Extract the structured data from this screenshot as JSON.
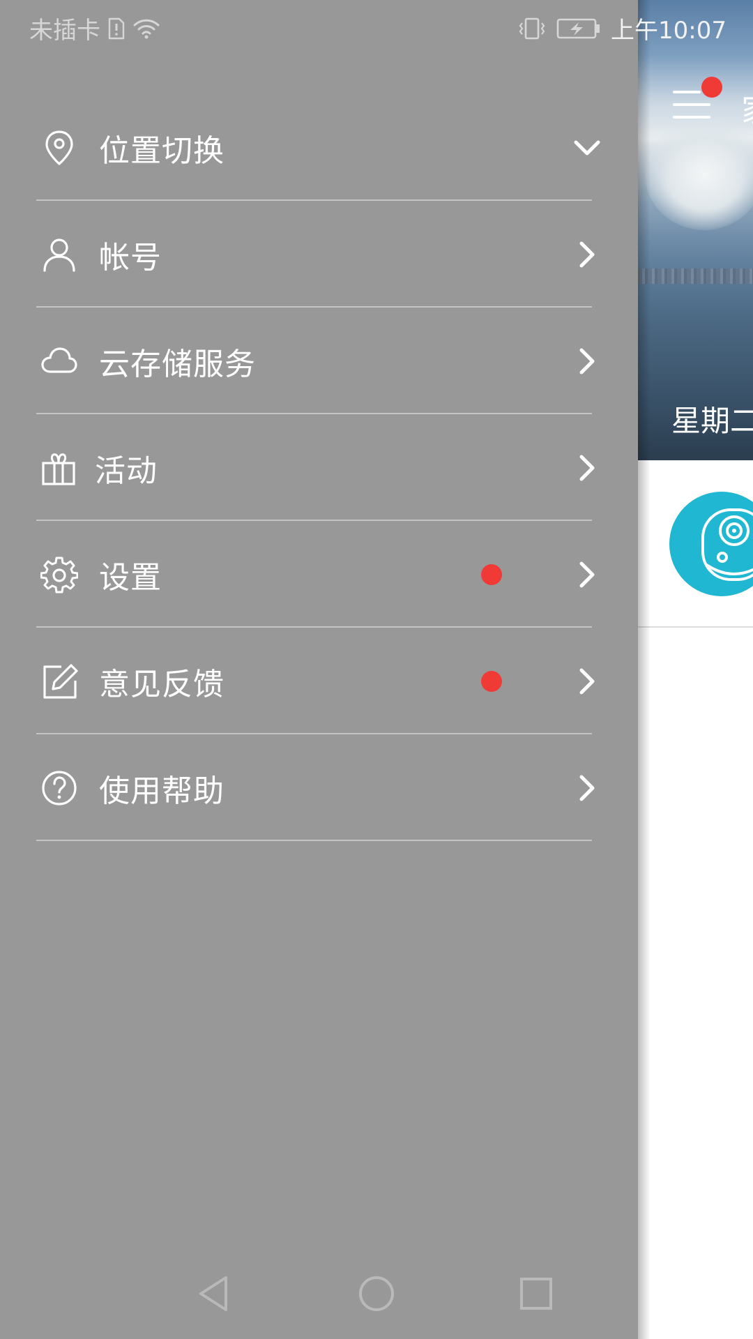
{
  "status_bar": {
    "carrier": "未插卡",
    "time": "上午10:07"
  },
  "background_app": {
    "title": "家",
    "date": "星期二",
    "colors": {
      "accent_dot": "#f03a36",
      "device_circle": "#1fb7d1"
    }
  },
  "drawer": {
    "background": "#999898",
    "items": [
      {
        "label": "位置切换",
        "icon": "location-pin-icon",
        "trailing": "chevron-down-icon",
        "badge": false
      },
      {
        "label": "帐号",
        "icon": "user-icon",
        "trailing": "chevron-right-icon",
        "badge": false
      },
      {
        "label": "云存储服务",
        "icon": "cloud-icon",
        "trailing": "chevron-right-icon",
        "badge": false
      },
      {
        "label": "活动",
        "icon": "gift-icon",
        "trailing": "chevron-right-icon",
        "badge": false
      },
      {
        "label": "设置",
        "icon": "gear-icon",
        "trailing": "chevron-right-icon",
        "badge": true
      },
      {
        "label": "意见反馈",
        "icon": "edit-icon",
        "trailing": "chevron-right-icon",
        "badge": true
      },
      {
        "label": "使用帮助",
        "icon": "help-icon",
        "trailing": "chevron-right-icon",
        "badge": false
      }
    ]
  },
  "nav_bar": {
    "buttons": [
      "back-icon",
      "home-icon",
      "recents-icon"
    ]
  }
}
